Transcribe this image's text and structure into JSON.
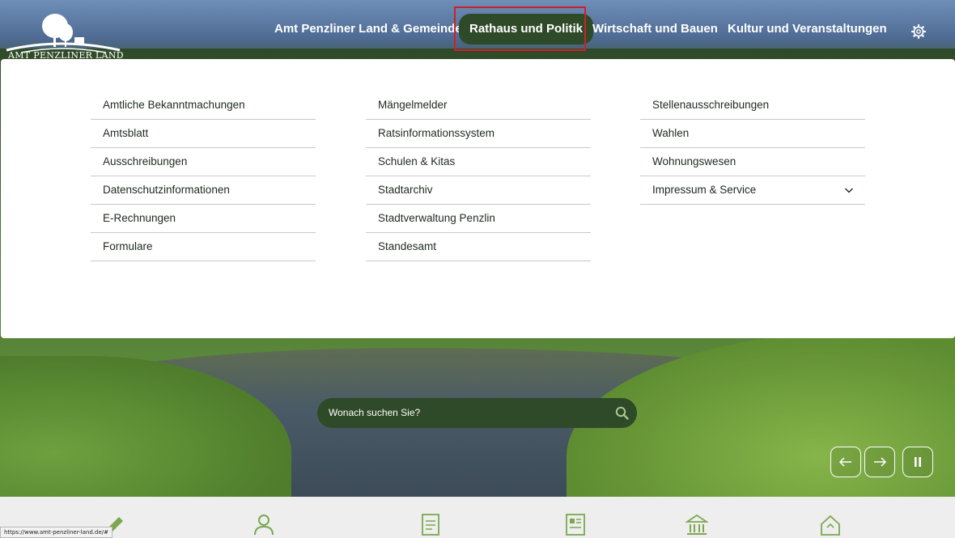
{
  "header": {
    "logo_text": "AMT PENZLINER LAND",
    "nav": [
      {
        "label": "Amt Penzliner Land & Gemeinden"
      },
      {
        "label": "Rathaus und Politik",
        "active": true
      },
      {
        "label": "Wirtschaft und Bauen"
      },
      {
        "label": "Kultur und Veranstaltungen"
      }
    ],
    "settings_icon": "gear-icon"
  },
  "mega_menu": {
    "columns": [
      [
        "Amtliche Bekanntmachungen",
        "Amtsblatt",
        "Ausschreibungen",
        "Datenschutzinformationen",
        "E-Rechnungen",
        "Formulare"
      ],
      [
        "Mängelmelder",
        "Ratsinformationssystem",
        "Schulen & Kitas",
        "Stadtarchiv",
        "Stadtverwaltung Penzlin",
        "Standesamt"
      ],
      [
        "Stellenausschreibungen",
        "Wahlen",
        "Wohnungswesen",
        "Impressum & Service"
      ]
    ]
  },
  "search": {
    "placeholder": "Wonach suchen Sie?",
    "icon": "search-icon"
  },
  "slider_controls": {
    "prev_icon": "arrow-left-icon",
    "next_icon": "arrow-right-icon",
    "pause_icon": "pause-icon"
  },
  "bottom_icons": [
    "pencil-icon",
    "person-icon",
    "document-icon",
    "newspaper-icon",
    "townhall-icon",
    "house-icon"
  ],
  "status_bar": {
    "url": "https://www.amt-penzliner-land.de/#"
  },
  "colors": {
    "brand_green": "#2f4a28",
    "highlight_red": "#d0202a",
    "menu_bg": "#ffffff",
    "bottom_bar": "#eeeeee"
  }
}
